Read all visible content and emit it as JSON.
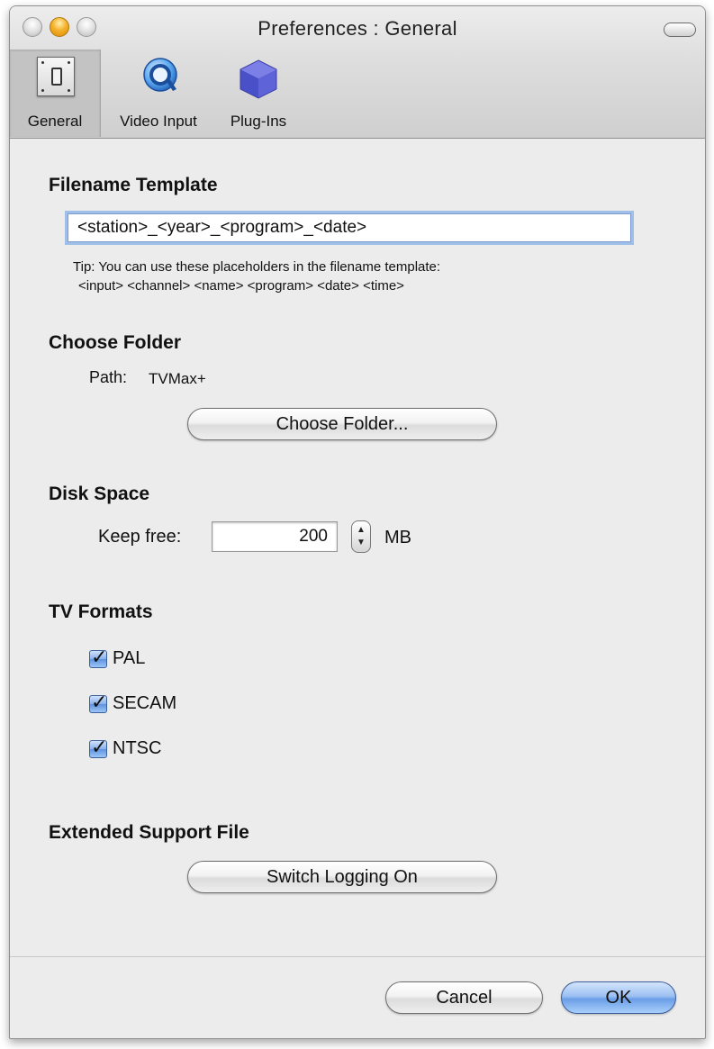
{
  "window": {
    "title": "Preferences : General"
  },
  "toolbar": {
    "items": [
      {
        "label": "General",
        "icon": "switch-icon",
        "selected": true
      },
      {
        "label": "Video Input",
        "icon": "quicktime-icon",
        "selected": false
      },
      {
        "label": "Plug-Ins",
        "icon": "cube-icon",
        "selected": false
      }
    ]
  },
  "filename_template": {
    "heading": "Filename Template",
    "value": "<station>_<year>_<program>_<date>",
    "tip_line1": "Tip: You can use these placeholders in the filename template:",
    "tip_line2": "<input> <channel> <name> <program> <date> <time>"
  },
  "choose_folder": {
    "heading": "Choose Folder",
    "path_label": "Path:",
    "path_value": "TVMax+",
    "button_label": "Choose Folder..."
  },
  "disk_space": {
    "heading": "Disk Space",
    "keep_free_label": "Keep free:",
    "keep_free_value": "200",
    "unit": "MB"
  },
  "tv_formats": {
    "heading": "TV Formats",
    "options": [
      {
        "label": "PAL",
        "checked": true
      },
      {
        "label": "SECAM",
        "checked": true
      },
      {
        "label": "NTSC",
        "checked": true
      }
    ]
  },
  "extended_support": {
    "heading": "Extended Support File",
    "button_label": "Switch Logging On"
  },
  "footer": {
    "cancel_label": "Cancel",
    "ok_label": "OK"
  },
  "colors": {
    "window_bg": "#ececec",
    "focus_ring": "#9fbfe9",
    "default_button": "#6a9ee6",
    "checkbox": "#5f92df"
  }
}
